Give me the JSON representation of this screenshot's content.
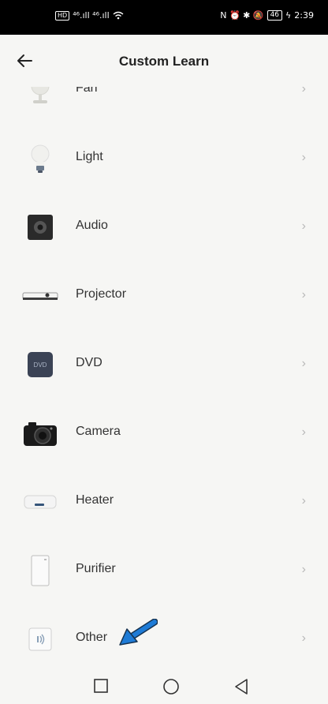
{
  "status_bar": {
    "left_hd": "HD",
    "left_signal": "⁴⁶.ıll ⁴⁶.ıll",
    "right_icons": "N ⏰ ✱ 🔕",
    "battery": "46",
    "time": "2:39"
  },
  "header": {
    "title": "Custom Learn"
  },
  "devices": [
    {
      "label": "Fan",
      "icon": "fan-icon"
    },
    {
      "label": "Light",
      "icon": "light-bulb-icon"
    },
    {
      "label": "Audio",
      "icon": "speaker-icon"
    },
    {
      "label": "Projector",
      "icon": "projector-icon"
    },
    {
      "label": "DVD",
      "icon": "dvd-icon",
      "icon_text": "DVD"
    },
    {
      "label": "Camera",
      "icon": "camera-icon"
    },
    {
      "label": "Heater",
      "icon": "heater-icon"
    },
    {
      "label": "Purifier",
      "icon": "purifier-icon"
    },
    {
      "label": "Other",
      "icon": "remote-signal-icon"
    }
  ],
  "chevron": "›",
  "colors": {
    "background": "#f6f6f4",
    "arrow_annotation": "#1e7bd6"
  }
}
